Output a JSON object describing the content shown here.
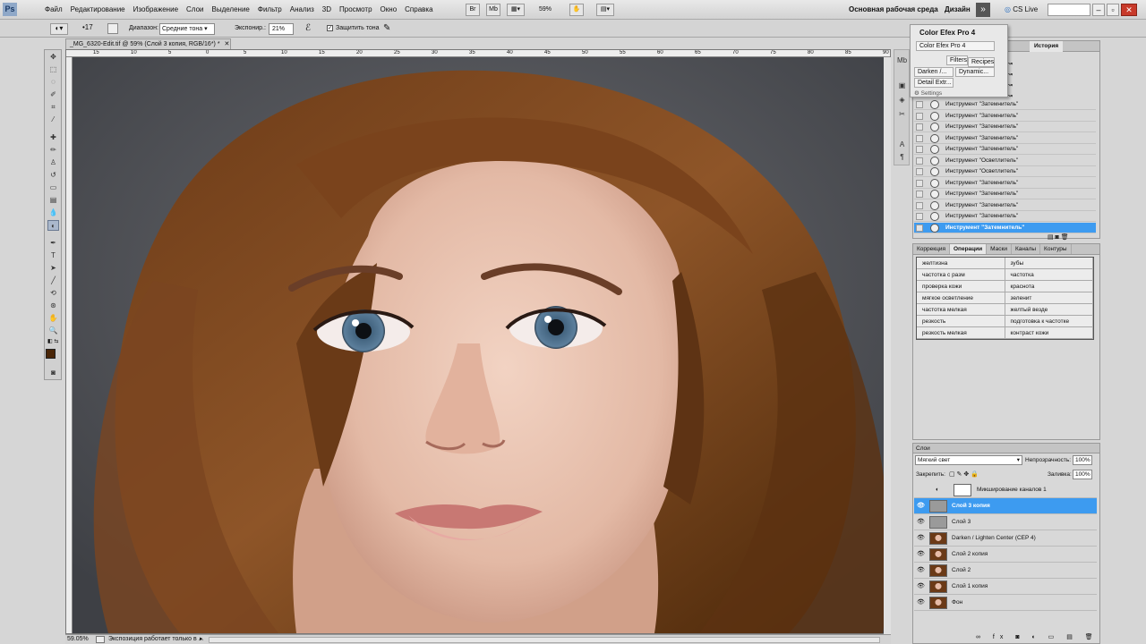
{
  "app": {
    "logo": "Ps"
  },
  "menu": [
    "Файл",
    "Редактирование",
    "Изображение",
    "Слои",
    "Выделение",
    "Фильтр",
    "Анализ",
    "3D",
    "Просмотр",
    "Окно",
    "Справка"
  ],
  "toolbar_top": {
    "zoom": "59%",
    "workspace": "Основная рабочая среда",
    "design": "Дизайн",
    "cs_live": "CS Live"
  },
  "options": {
    "range_label": "Диапазон:",
    "range_value": "Средние тона",
    "exposure_label": "Экспонир.:",
    "exposure_value": "21%",
    "protect_label": "Защитить тона"
  },
  "document": {
    "tab_title": "_MG_6320-Edit.tif @ 59% (Слой 3 копия, RGB/16*) *"
  },
  "ruler_ticks": [
    "15",
    "10",
    "5",
    "0",
    "5",
    "10",
    "15",
    "20",
    "25",
    "30",
    "35",
    "40",
    "45",
    "50",
    "55",
    "60",
    "65",
    "70",
    "75",
    "80",
    "85",
    "90"
  ],
  "status": {
    "zoom": "59.05%",
    "message": "Экспозиция работает только в ..."
  },
  "cef_panel": {
    "title": "Color Efex Pro 4",
    "item": "Color Efex Pro 4",
    "filters": "Filters",
    "recipes": "Recipes",
    "darken": "Darken /...",
    "dynamic": "Dynamic...",
    "detail": "Detail Extr...",
    "settings": "Settings"
  },
  "history": {
    "tab": "История",
    "items": [
      {
        "label": "Инструмент \"Затемнитель\"",
        "selected": false
      },
      {
        "label": "Инструмент \"Затемнитель\"",
        "selected": false
      },
      {
        "label": "Инструмент \"Затемнитель\"",
        "selected": false
      },
      {
        "label": "Инструмент \"Затемнитель\"",
        "selected": false
      },
      {
        "label": "Инструмент \"Затемнитель\"",
        "selected": false
      },
      {
        "label": "Инструмент \"Осветлитель\"",
        "selected": false
      },
      {
        "label": "Инструмент \"Осветлитель\"",
        "selected": false
      },
      {
        "label": "Инструмент \"Затемнитель\"",
        "selected": false
      },
      {
        "label": "Инструмент \"Затемнитель\"",
        "selected": false
      },
      {
        "label": "Инструмент \"Затемнитель\"",
        "selected": false
      },
      {
        "label": "Инструмент \"Затемнитель\"",
        "selected": false
      },
      {
        "label": "Инструмент \"Затемнитель\"",
        "selected": true
      }
    ]
  },
  "operations": {
    "tabs": [
      "Коррекция",
      "Операции",
      "Маски",
      "Каналы",
      "Контуры"
    ],
    "active_tab": "Операции",
    "rows": [
      [
        "желтизна",
        "зубы"
      ],
      [
        "частотка с разм",
        "частотка"
      ],
      [
        "проверка кожи",
        "краснота"
      ],
      [
        "мягкое осветление",
        "зеленит"
      ],
      [
        "частотка мелкая",
        "желтый везде"
      ],
      [
        "резкость",
        "подготовка к частотке"
      ],
      [
        "резкость мелкая",
        "контраст кожи"
      ]
    ]
  },
  "layers": {
    "tab": "Слои",
    "blend_mode": "Мягкий свет",
    "opacity_label": "Непрозрачность:",
    "opacity": "100%",
    "lock_label": "Закрепить:",
    "fill_label": "Заливка:",
    "fill": "100%",
    "items": [
      {
        "name": "Микширование каналов 1",
        "visible": false,
        "thumb": "adjust",
        "selected": false
      },
      {
        "name": "Слой 3 копия",
        "visible": true,
        "thumb": "gray",
        "selected": true
      },
      {
        "name": "Слой 3",
        "visible": true,
        "thumb": "gray",
        "selected": false
      },
      {
        "name": "Darken / Lighten Center (CEP 4)",
        "visible": true,
        "thumb": "photo",
        "selected": false
      },
      {
        "name": "Слой 2 копия",
        "visible": true,
        "thumb": "photo",
        "selected": false
      },
      {
        "name": "Слой 2",
        "visible": true,
        "thumb": "photo",
        "selected": false
      },
      {
        "name": "Слой 1 копия",
        "visible": true,
        "thumb": "photo",
        "selected": false
      },
      {
        "name": "Фон",
        "visible": true,
        "thumb": "photo",
        "selected": false
      }
    ]
  },
  "colors": {
    "selection": "#3d9bf0",
    "foreground": "#4a2608",
    "background": "#ffffff"
  }
}
